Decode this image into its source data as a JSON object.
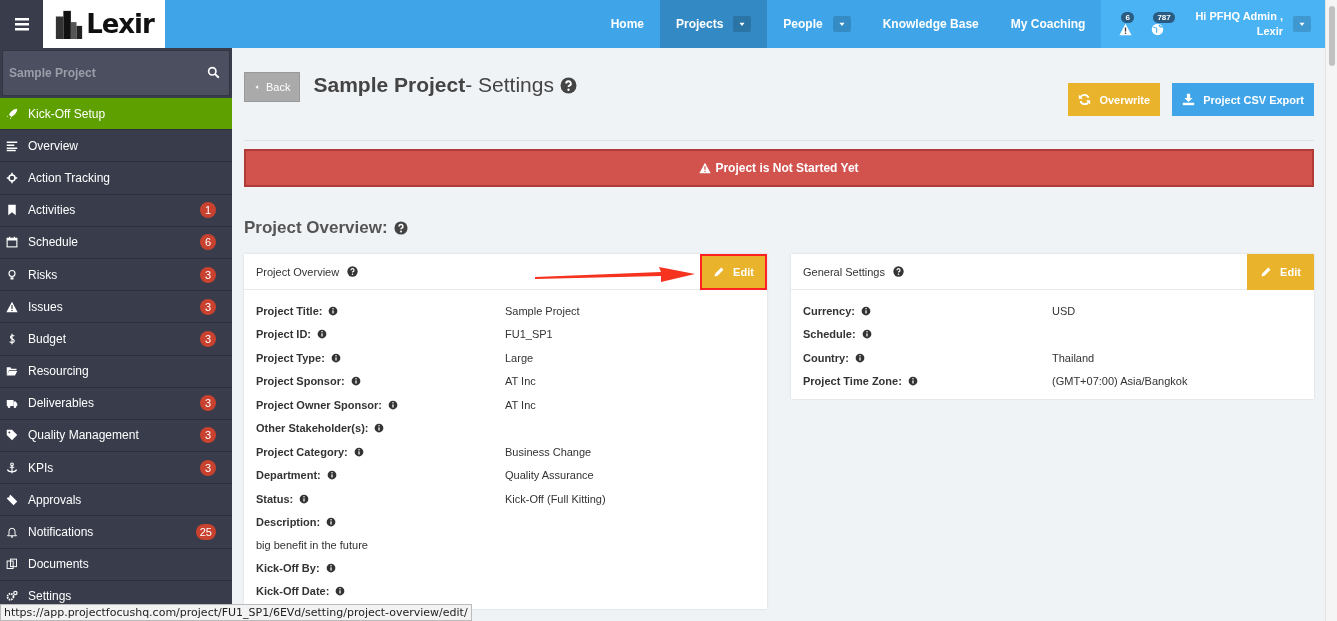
{
  "topbar": {
    "logo": "Lexir",
    "nav": [
      {
        "label": "Home",
        "selected": false,
        "dropdown": false
      },
      {
        "label": "Projects",
        "selected": true,
        "dropdown": true
      },
      {
        "label": "People",
        "selected": false,
        "dropdown": true
      },
      {
        "label": "Knowledge Base",
        "selected": false,
        "dropdown": false
      },
      {
        "label": "My Coaching",
        "selected": false,
        "dropdown": false
      }
    ],
    "alerts": [
      {
        "kind": "warning",
        "count": "6"
      },
      {
        "kind": "globe",
        "count": "787"
      }
    ],
    "user": {
      "line1": "Hi PFHQ Admin ,",
      "line2": "Lexir"
    }
  },
  "sidebar": {
    "search": {
      "placeholder": "Sample Project"
    },
    "items": [
      {
        "label": "Kick-Off Setup",
        "selected": true
      },
      {
        "label": "Overview",
        "selected": false
      },
      {
        "label": "Action Tracking",
        "selected": false
      },
      {
        "label": "Activities",
        "selected": false,
        "badge": "1"
      },
      {
        "label": "Schedule",
        "selected": false,
        "badge": "6"
      },
      {
        "label": "Risks",
        "selected": false,
        "badge": "3"
      },
      {
        "label": "Issues",
        "selected": false,
        "badge": "3"
      },
      {
        "label": "Budget",
        "selected": false,
        "badge": "3"
      },
      {
        "label": "Resourcing",
        "selected": false
      },
      {
        "label": "Deliverables",
        "selected": false,
        "badge": "3"
      },
      {
        "label": "Quality Management",
        "selected": false,
        "badge": "3"
      },
      {
        "label": "KPIs",
        "selected": false,
        "badge": "3"
      },
      {
        "label": "Approvals",
        "selected": false
      },
      {
        "label": "Notifications",
        "selected": false,
        "badge": "25"
      },
      {
        "label": "Documents",
        "selected": false
      },
      {
        "label": "Settings",
        "selected": false
      }
    ]
  },
  "header": {
    "back": "Back",
    "title_bold": "Sample Project",
    "title_rest": "- Settings",
    "buttons": [
      {
        "kind": "overwrite",
        "label": "Overwrite"
      },
      {
        "kind": "export",
        "label": "Project CSV Export"
      }
    ]
  },
  "alert": "Project is Not Started Yet",
  "section_title": "Project Overview:",
  "cards": [
    {
      "title": "Project Overview",
      "edit": "Edit",
      "highlighted": true,
      "rows": [
        {
          "label": "Project Title:",
          "value": "Sample Project"
        },
        {
          "label": "Project ID:",
          "value": "FU1_SP1"
        },
        {
          "label": "Project Type:",
          "value": "Large"
        },
        {
          "label": "Project Sponsor:",
          "value": "AT Inc"
        },
        {
          "label": "Project Owner Sponsor:",
          "value": "AT Inc"
        },
        {
          "label": "Other Stakeholder(s):"
        },
        {
          "label": "Project Category:",
          "value": "Business Change"
        },
        {
          "label": "Department:",
          "value": "Quality Assurance"
        },
        {
          "label": "Status:",
          "value": "Kick-Off (Full Kitting)"
        },
        {
          "label": "Description:",
          "below": "big benefit in the future"
        },
        {
          "label": "Kick-Off By:"
        },
        {
          "label": "Kick-Off Date:"
        }
      ]
    },
    {
      "title": "General Settings",
      "edit": "Edit",
      "highlighted": false,
      "rows": [
        {
          "label": "Currency:",
          "value": "USD"
        },
        {
          "label": "Schedule:"
        },
        {
          "label": "Country:",
          "value": "Thailand"
        },
        {
          "label": "Project Time Zone:",
          "value": "(GMT+07:00) Asia/Bangkok"
        }
      ]
    }
  ],
  "status_url": "https://app.projectfocushq.com/project/FU1_SP1/6EVd/setting/project-overview/edit/"
}
